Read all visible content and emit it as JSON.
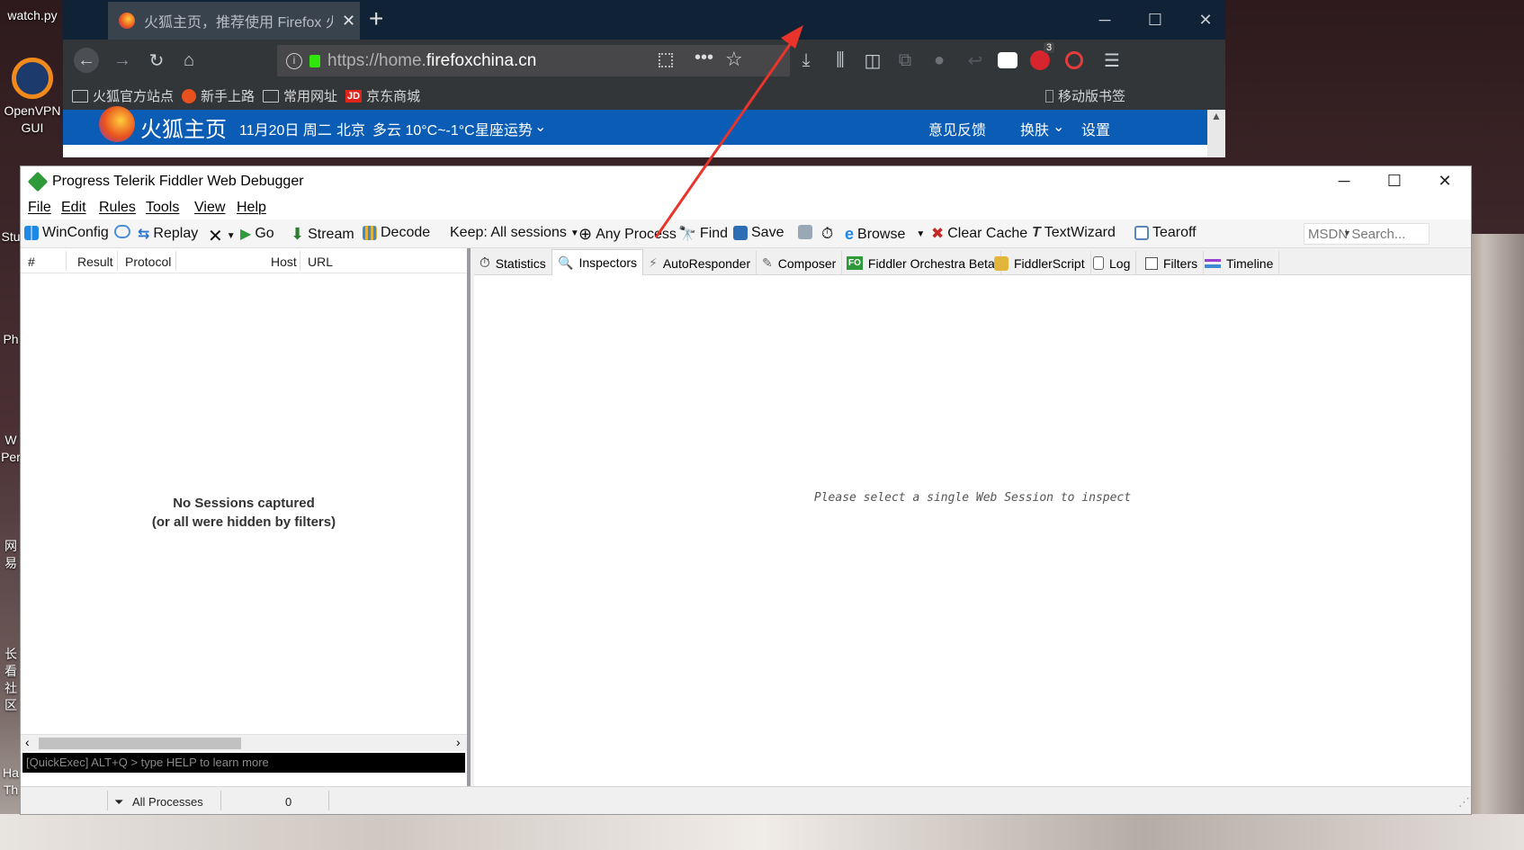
{
  "desktop": {
    "icons": [
      {
        "label": "watch.py"
      },
      {
        "label": "OpenVPN GUI"
      },
      {
        "label": "Stu"
      },
      {
        "label": "Ph"
      },
      {
        "label": "W Per"
      },
      {
        "label": "网易"
      },
      {
        "label": "长看 社区"
      },
      {
        "label": "Ha Th"
      }
    ]
  },
  "firefox": {
    "tab_title": "火狐主页，推荐使用 Firefox 火",
    "url_prefix": "https://home.",
    "url_host": "firefoxchina.cn",
    "bookmarks": [
      "火狐官方站点",
      "新手上路",
      "常用网址",
      "京东商城"
    ],
    "mobile_bookmarks": "移动版书签",
    "page": {
      "brand": "火狐主页",
      "date": "11月20日 周二",
      "city": "北京",
      "weather": "多云 10°C~-1°C",
      "horoscope": "星座运势",
      "feedback": "意见反馈",
      "skin": "换肤",
      "settings": "设置"
    },
    "abp_badge": "3",
    "colors": {
      "tabbar": "#0f2236",
      "pagebar": "#0a5cb5"
    }
  },
  "fiddler": {
    "title": "Progress Telerik Fiddler Web Debugger",
    "menu": [
      "File",
      "Edit",
      "Rules",
      "Tools",
      "View",
      "Help"
    ],
    "toolbar": {
      "winconfig": "WinConfig",
      "replay": "Replay",
      "go": "Go",
      "stream": "Stream",
      "decode": "Decode",
      "keep": "Keep: All sessions",
      "any_process": "Any Process",
      "find": "Find",
      "save": "Save",
      "browse": "Browse",
      "clear_cache": "Clear Cache",
      "textwizard": "TextWizard",
      "tearoff": "Tearoff",
      "msdn_placeholder": "MSDN Search..."
    },
    "columns": [
      "#",
      "Result",
      "Protocol",
      "Host",
      "URL"
    ],
    "empty_line1": "No Sessions captured",
    "empty_line2": "(or all were hidden by filters)",
    "quickexec": "[QuickExec] ALT+Q > type HELP to learn more",
    "tabs": [
      "Statistics",
      "Inspectors",
      "AutoResponder",
      "Composer",
      "Fiddler Orchestra Beta",
      "FiddlerScript",
      "Log",
      "Filters",
      "Timeline"
    ],
    "fo_badge": "FO",
    "inspect_hint": "Please select a single Web Session to inspect",
    "status": {
      "processes": "All Processes",
      "count": "0"
    }
  },
  "annotation_color": "#e8342a"
}
